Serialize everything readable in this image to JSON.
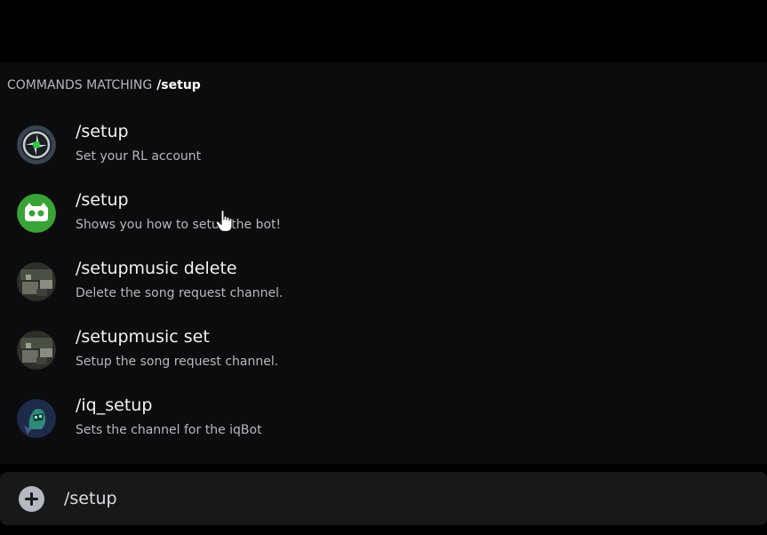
{
  "header": {
    "label": "COMMANDS MATCHING",
    "query": "/setup"
  },
  "commands": [
    {
      "name": "/setup",
      "description": "Set your RL account",
      "icon": "rl-tracker-bot-avatar-icon"
    },
    {
      "name": "/setup",
      "description": "Shows you how to setup the bot!",
      "icon": "green-bot-avatar-icon"
    },
    {
      "name": "/setupmusic delete",
      "description": "Delete the song request channel.",
      "icon": "music-bot-avatar-icon"
    },
    {
      "name": "/setupmusic set",
      "description": "Setup the song request channel.",
      "icon": "music-bot-avatar-icon"
    },
    {
      "name": "/iq_setup",
      "description": "Sets the channel for the iqBot",
      "icon": "iqbot-avatar-icon"
    }
  ],
  "input": {
    "value": "/setup",
    "plus_icon": "add-circle-icon"
  },
  "colors": {
    "background": "#000000",
    "popup": "#0c0c0e",
    "input_bar": "#18181b",
    "text_primary": "#f2f3f5",
    "text_secondary": "#b5b8bf"
  }
}
